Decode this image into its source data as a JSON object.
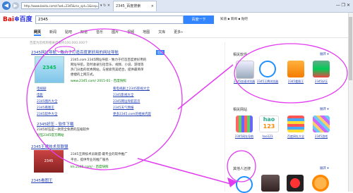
{
  "browser": {
    "address_url": "http://www.baidu.com/s?wd=2345&rsv_spt=1&issp=1",
    "address_buttons": "▾ ↻ ✕",
    "tab_title": "2345_百度搜索",
    "tab_close": "×",
    "window_buttons": "—  ❐  ✕"
  },
  "header": {
    "logo_part1": "Bai",
    "logo_paw": "✽",
    "logo_part2": "百度",
    "search_value": "2345",
    "search_button": "百度一下",
    "right_links": "知道 ▪ 新闻 ▪ 贴吧"
  },
  "nav": {
    "items": [
      "网页",
      "新闻",
      "贴吧",
      "知道",
      "音乐",
      "图片",
      "视频",
      "地图",
      "文库",
      "更多»"
    ]
  },
  "result_count": "百度为您找到相关结果约100,000,000个",
  "results": {
    "r1": {
      "title": "2345网址导航 - 致力于打造百度更好用的网址导航",
      "badge": "官网",
      "lines": [
        "2345.com 2345网址导航 - 致力于打造百度更好用的",
        "网址导航，及时收录包括音乐、视频、小说、游戏等",
        "热门分类的优秀网站，与搜索完美结合，提供最简单",
        "便捷的上网方式。"
      ],
      "url": "www.2345.com/ 2015-01 - 百度快照",
      "links": [
        [
          "电视剧",
          "看电视剧上2345影视大全"
        ],
        [
          "电影",
          "2345影视大全"
        ],
        [
          "2345图片大全",
          "2345网址导航首页"
        ],
        [
          "2345看图王",
          "2345天气预报"
        ],
        [
          "2345软件大全",
          "更多2345.com的相关内容"
        ]
      ]
    },
    "r2": {
      "title": "2345好压 - 软件下载",
      "line1": "2345好压是一款完全免费的压缩软件",
      "line2": "好压2345官方网站"
    },
    "r3": {
      "title": "2345王牌技术员联盟",
      "lines": [
        "2345王牌技术员联盟-最专业的软件推广",
        "平台，提供专业的推广服务",
        "lm.2345.com/ - 百度快照"
      ]
    },
    "r4": {
      "title": "2345看图王"
    }
  },
  "sidebar": {
    "section1": {
      "title": "相关软件",
      "more": "展开 ▾",
      "apps": [
        "2345加速浏览器",
        "2345王牌浏览器",
        "2345看图王",
        "2345好压"
      ]
    },
    "section2": {
      "title": "相关网站",
      "more": "展开 ▾",
      "apps": [
        "2345网址导航",
        "hao123",
        "百度网址大全",
        "2345游戏"
      ],
      "hao_label1": "hao",
      "hao_label2": "123"
    },
    "section3": {
      "title": "其他人还搜",
      "more": "展开 ▾"
    }
  },
  "colors": {
    "annotation": "#e23cf0",
    "baidu_red": "#e10601",
    "baidu_blue": "#2932e1",
    "button_blue": "#3385ff",
    "link": "#2440b3"
  }
}
